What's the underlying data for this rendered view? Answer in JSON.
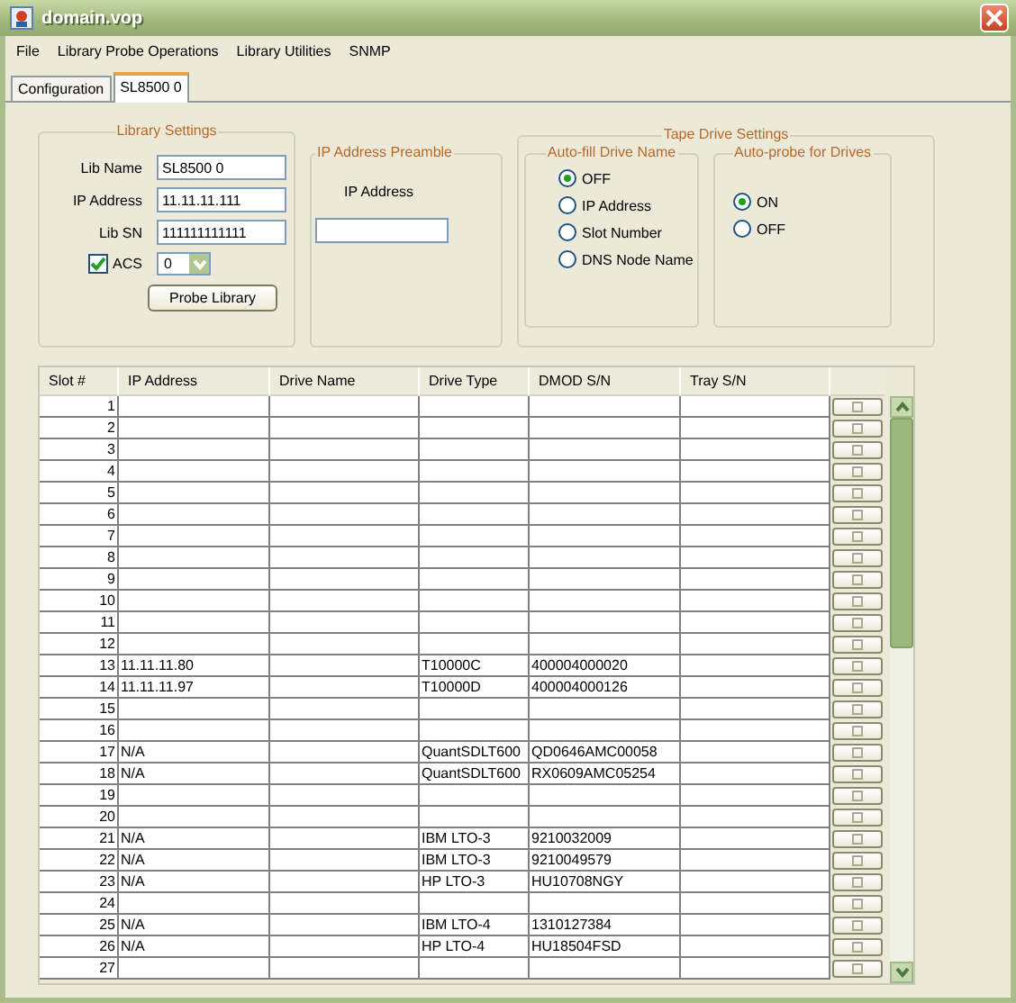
{
  "window": {
    "title": "domain.vop"
  },
  "menu": [
    "File",
    "Library Probe Operations",
    "Library Utilities",
    "SNMP"
  ],
  "tabs": [
    {
      "label": "Configuration",
      "selected": false
    },
    {
      "label": "SL8500 0",
      "selected": true
    }
  ],
  "library_settings": {
    "title": "Library Settings",
    "lib_name_label": "Lib Name",
    "lib_name": "SL8500 0",
    "ip_label": "IP Address",
    "ip": "11.11.11.111",
    "sn_label": "Lib SN",
    "sn": "111111111111",
    "acs_label": "ACS",
    "acs_checked": true,
    "acs_value": "0",
    "probe_button": "Probe Library"
  },
  "ip_preamble": {
    "title": "IP Address Preamble",
    "label": "IP Address"
  },
  "tape_drive_settings": {
    "title": "Tape Drive Settings",
    "groups": [
      {
        "title": "Auto-fill Drive Name",
        "options": [
          {
            "label": "OFF",
            "selected": true
          },
          {
            "label": "IP Address",
            "selected": false
          },
          {
            "label": "Slot Number",
            "selected": false
          },
          {
            "label": "DNS Node Name",
            "selected": false
          }
        ]
      },
      {
        "title": "Auto-probe for Drives",
        "options": [
          {
            "label": "ON",
            "selected": true
          },
          {
            "label": "OFF",
            "selected": false
          }
        ]
      }
    ]
  },
  "table": {
    "columns": [
      "Slot #",
      "IP Address",
      "Drive Name",
      "Drive Type",
      "DMOD S/N",
      "Tray S/N"
    ],
    "rows": [
      {
        "slot": "1"
      },
      {
        "slot": "2"
      },
      {
        "slot": "3"
      },
      {
        "slot": "4"
      },
      {
        "slot": "5"
      },
      {
        "slot": "6"
      },
      {
        "slot": "7"
      },
      {
        "slot": "8"
      },
      {
        "slot": "9"
      },
      {
        "slot": "10"
      },
      {
        "slot": "11"
      },
      {
        "slot": "12"
      },
      {
        "slot": "13",
        "ip": "11.11.11.80",
        "drive_type": "T10000C",
        "dmod_sn": "400004000020"
      },
      {
        "slot": "14",
        "ip": "11.11.11.97",
        "drive_type": "T10000D",
        "dmod_sn": "400004000126"
      },
      {
        "slot": "15"
      },
      {
        "slot": "16"
      },
      {
        "slot": "17",
        "ip": "N/A",
        "drive_type": "QuantSDLT600",
        "dmod_sn": "QD0646AMC00058"
      },
      {
        "slot": "18",
        "ip": "N/A",
        "drive_type": "QuantSDLT600",
        "dmod_sn": "RX0609AMC05254"
      },
      {
        "slot": "19"
      },
      {
        "slot": "20"
      },
      {
        "slot": "21",
        "ip": "N/A",
        "drive_type": "IBM LTO-3",
        "dmod_sn": "9210032009"
      },
      {
        "slot": "22",
        "ip": "N/A",
        "drive_type": "IBM LTO-3",
        "dmod_sn": "9210049579"
      },
      {
        "slot": "23",
        "ip": "N/A",
        "drive_type": "HP LTO-3",
        "dmod_sn": "HU10708NGY"
      },
      {
        "slot": "24"
      },
      {
        "slot": "25",
        "ip": "N/A",
        "drive_type": "IBM LTO-4",
        "dmod_sn": "1310127384"
      },
      {
        "slot": "26",
        "ip": "N/A",
        "drive_type": "HP LTO-4",
        "dmod_sn": "HU18504FSD"
      },
      {
        "slot": "27"
      }
    ]
  }
}
